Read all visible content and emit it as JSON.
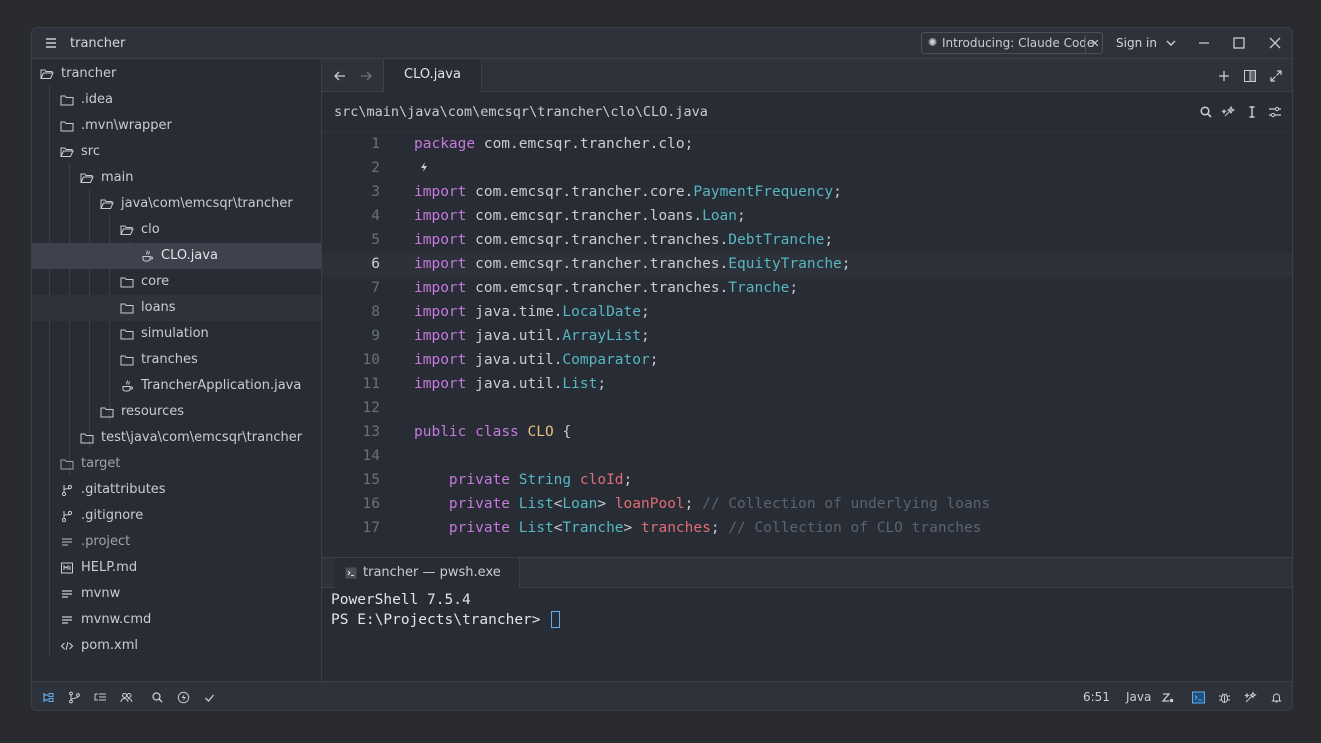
{
  "app": {
    "title": "trancher",
    "promo_label": "Introducing: Claude Code",
    "sign_in": "Sign in"
  },
  "sidebar": {
    "items": [
      {
        "label": "trancher",
        "icon": "folder-open-icon"
      },
      {
        "label": ".idea",
        "icon": "folder-icon"
      },
      {
        "label": ".mvn\\wrapper",
        "icon": "folder-icon"
      },
      {
        "label": "src",
        "icon": "folder-open-icon"
      },
      {
        "label": "main",
        "icon": "folder-open-icon"
      },
      {
        "label": "java\\com\\emcsqr\\trancher",
        "icon": "folder-open-icon"
      },
      {
        "label": "clo",
        "icon": "folder-open-icon"
      },
      {
        "label": "CLO.java",
        "icon": "java-file-icon"
      },
      {
        "label": "core",
        "icon": "folder-icon"
      },
      {
        "label": "loans",
        "icon": "folder-icon"
      },
      {
        "label": "simulation",
        "icon": "folder-icon"
      },
      {
        "label": "tranches",
        "icon": "folder-icon"
      },
      {
        "label": "TrancherApplication.java",
        "icon": "java-file-icon"
      },
      {
        "label": "resources",
        "icon": "folder-icon"
      },
      {
        "label": "test\\java\\com\\emcsqr\\trancher",
        "icon": "folder-icon"
      },
      {
        "label": "target",
        "icon": "folder-icon"
      },
      {
        "label": ".gitattributes",
        "icon": "git-icon"
      },
      {
        "label": ".gitignore",
        "icon": "git-icon"
      },
      {
        "label": ".project",
        "icon": "text-file-icon"
      },
      {
        "label": "HELP.md",
        "icon": "markdown-icon"
      },
      {
        "label": "mvnw",
        "icon": "text-file-icon"
      },
      {
        "label": "mvnw.cmd",
        "icon": "text-file-icon"
      },
      {
        "label": "pom.xml",
        "icon": "code-file-icon"
      }
    ]
  },
  "editor": {
    "tab_label": "CLO.java",
    "breadcrumb": "src\\main\\java\\com\\emcsqr\\trancher\\clo\\CLO.java",
    "current_line": 6,
    "line_numbers": [
      "1",
      "2",
      "3",
      "4",
      "5",
      "6",
      "7",
      "8",
      "9",
      "10",
      "11",
      "12",
      "13",
      "14",
      "15",
      "16",
      "17"
    ]
  },
  "terminal": {
    "tab_label": "trancher — pwsh.exe",
    "line1": "PowerShell 7.5.4",
    "prompt": "PS E:\\Projects\\trancher> "
  },
  "status": {
    "cursor_position": "6:51",
    "language": "Java"
  },
  "colors": {
    "keyword": "#c678dd",
    "type": "#56b6c2",
    "field": "#e06c75",
    "comment": "#5c6370",
    "class_name": "#e5c07b",
    "accent": "#61afef"
  }
}
